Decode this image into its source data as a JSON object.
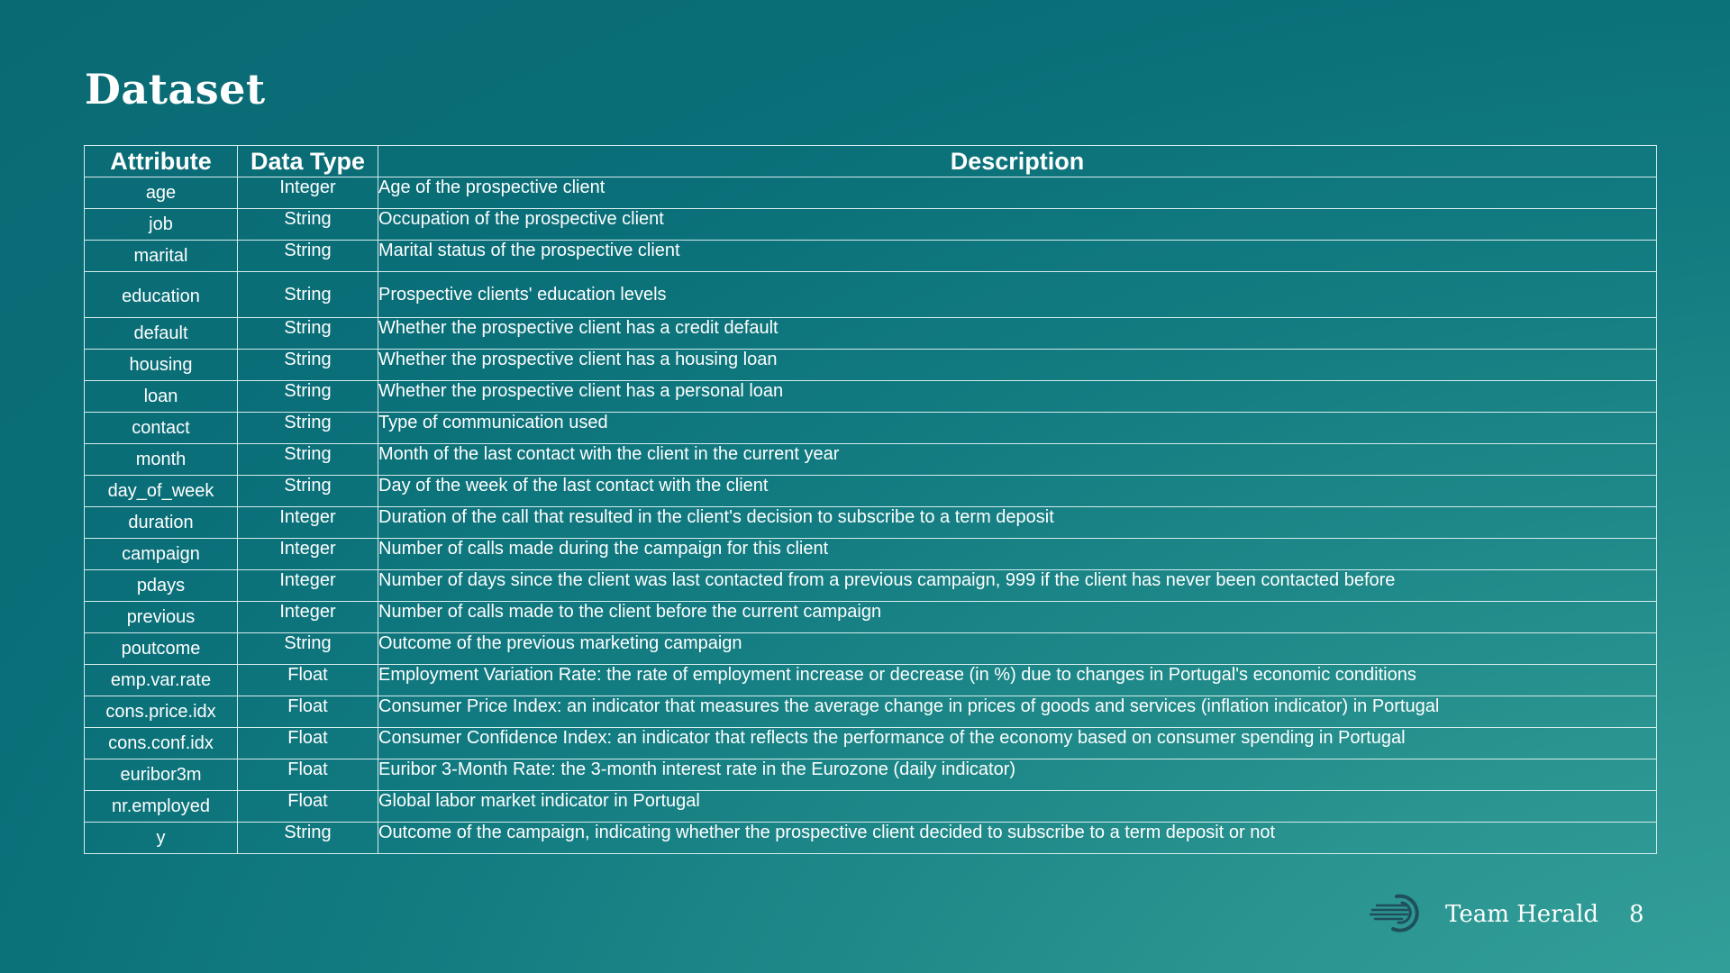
{
  "slide": {
    "title": "Dataset",
    "footer": {
      "team": "Team Herald",
      "page": "8"
    }
  },
  "table": {
    "headers": [
      "Attribute",
      "Data Type",
      "Description"
    ],
    "rows": [
      {
        "attr": "age",
        "type": "Integer",
        "desc": "Age of the prospective client"
      },
      {
        "attr": "job",
        "type": "String",
        "desc": "Occupation of the prospective client"
      },
      {
        "attr": "marital",
        "type": "String",
        "desc": "Marital status of the prospective client"
      },
      {
        "attr": "education",
        "type": "String",
        "desc": "Prospective clients' education levels"
      },
      {
        "attr": "default",
        "type": "String",
        "desc": "Whether the prospective client has a credit default"
      },
      {
        "attr": "housing",
        "type": "String",
        "desc": "Whether the prospective client has a housing loan"
      },
      {
        "attr": "loan",
        "type": "String",
        "desc": "Whether the prospective client has a personal loan"
      },
      {
        "attr": "contact",
        "type": "String",
        "desc": "Type of communication used"
      },
      {
        "attr": "month",
        "type": "String",
        "desc": "Month of the last contact with the client in the current year"
      },
      {
        "attr": "day_of_week",
        "type": "String",
        "desc": "Day of the week of the last contact with the client"
      },
      {
        "attr": "duration",
        "type": "Integer",
        "desc": "Duration of the call that resulted in the client's decision to subscribe to a term deposit"
      },
      {
        "attr": "campaign",
        "type": "Integer",
        "desc": "Number of calls made during the campaign for this client"
      },
      {
        "attr": "pdays",
        "type": "Integer",
        "desc": "Number of days since the client was last contacted from a previous campaign, 999 if the client has never been contacted before"
      },
      {
        "attr": "previous",
        "type": "Integer",
        "desc": "Number of calls made to the client before the current campaign"
      },
      {
        "attr": "poutcome",
        "type": "String",
        "desc": "Outcome of the previous marketing campaign"
      },
      {
        "attr": "emp.var.rate",
        "type": "Float",
        "desc": "Employment Variation Rate: the rate of employment increase or decrease (in %) due to changes in Portugal's economic conditions"
      },
      {
        "attr": "cons.price.idx",
        "type": "Float",
        "desc": "Consumer Price Index: an indicator that measures the average change in prices of goods and services (inflation indicator) in Portugal"
      },
      {
        "attr": "cons.conf.idx",
        "type": "Float",
        "desc": "Consumer Confidence Index: an indicator that reflects the performance of the economy based on consumer spending in Portugal"
      },
      {
        "attr": "euribor3m",
        "type": "Float",
        "desc": "Euribor 3-Month Rate: the 3-month interest rate in the Eurozone (daily indicator)"
      },
      {
        "attr": "nr.employed",
        "type": "Float",
        "desc": "Global labor market indicator in Portugal"
      },
      {
        "attr": "y",
        "type": "String",
        "desc": "Outcome of the campaign, indicating whether the prospective client decided to subscribe to a term deposit or not"
      }
    ]
  },
  "colors": {
    "background": "#0a6f78",
    "text": "#ffffff",
    "grid": "#d6ecec"
  },
  "icons": {
    "logo": "swoosh-logo-icon"
  }
}
